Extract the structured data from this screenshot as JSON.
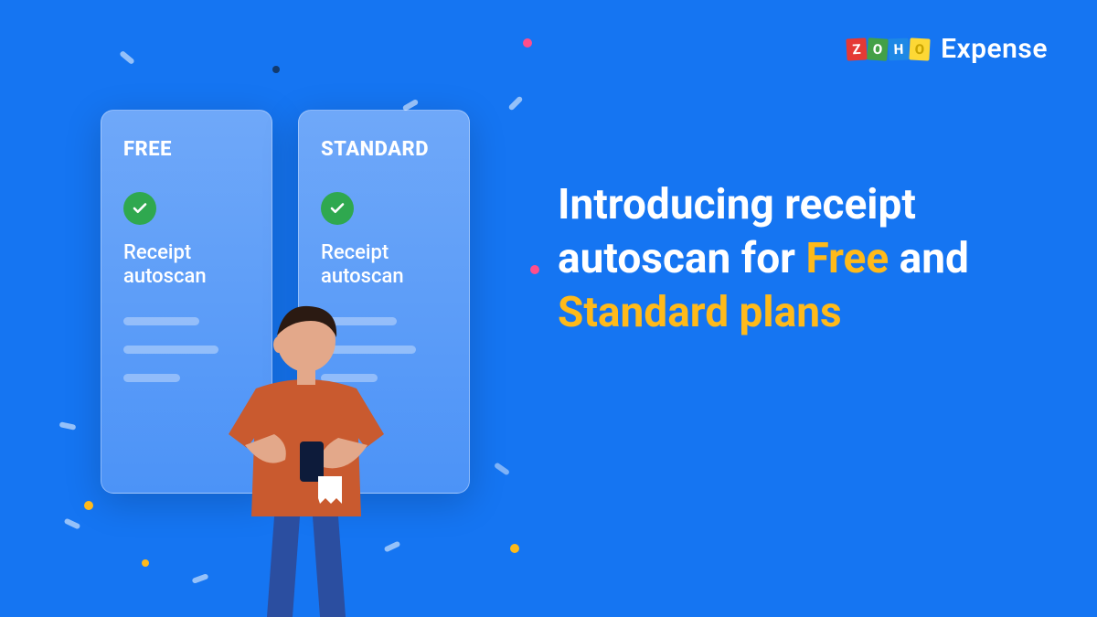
{
  "brand": {
    "name": "ZOHO",
    "product": "Expense",
    "tile_colors": [
      "#e53935",
      "#43a047",
      "#1e88e5",
      "#fdd835"
    ]
  },
  "plans": [
    {
      "name": "FREE",
      "feature": "Receipt autoscan",
      "checked": true
    },
    {
      "name": "STANDARD",
      "feature": "Receipt autoscan",
      "checked": true
    }
  ],
  "headline": {
    "pre": "Introducing receipt autoscan for ",
    "free": "Free",
    "mid": " and ",
    "standard": "Standard plans"
  },
  "colors": {
    "background": "#1575f2",
    "accent": "#ffba1a",
    "check": "#2fa84f",
    "pink": "#ff4e8b"
  }
}
